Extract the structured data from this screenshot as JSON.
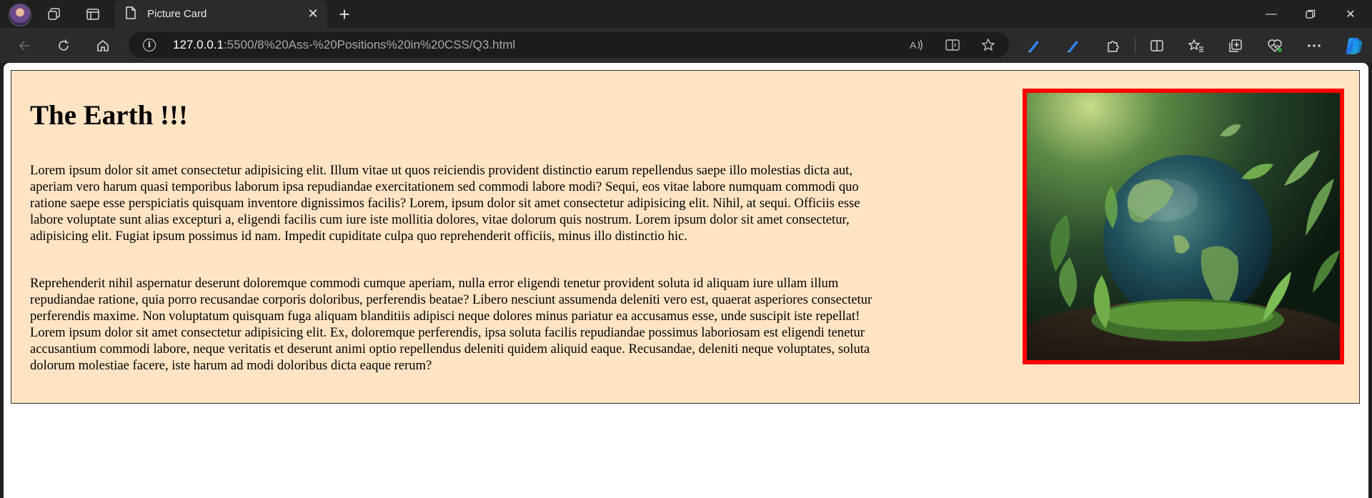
{
  "browser": {
    "tab_title": "Picture Card",
    "url_host": "127.0.0.1",
    "url_path": ":5500/8%20Ass-%20Positions%20in%20CSS/Q3.html"
  },
  "page": {
    "heading": "The Earth !!!",
    "paragraph1": "Lorem ipsum dolor sit amet consectetur adipisicing elit. Illum vitae ut quos reiciendis provident distinctio earum repellendus saepe illo molestias dicta aut, aperiam vero harum quasi temporibus laborum ipsa repudiandae exercitationem sed commodi labore modi? Sequi, eos vitae labore numquam commodi quo ratione saepe esse perspiciatis quisquam inventore dignissimos facilis? Lorem, ipsum dolor sit amet consectetur adipisicing elit. Nihil, at sequi. Officiis esse labore voluptate sunt alias excepturi a, eligendi facilis cum iure iste mollitia dolores, vitae dolorum quis nostrum. Lorem ipsum dolor sit amet consectetur, adipisicing elit. Fugiat ipsum possimus id nam. Impedit cupiditate culpa quo reprehenderit officiis, minus illo distinctio hic.",
    "paragraph2": "Reprehenderit nihil aspernatur deserunt doloremque commodi cumque aperiam, nulla error eligendi tenetur provident soluta id aliquam iure ullam illum repudiandae ratione, quia porro recusandae corporis doloribus, perferendis beatae? Libero nesciunt assumenda deleniti vero est, quaerat asperiores consectetur perferendis maxime. Non voluptatum quisquam fuga aliquam blanditiis adipisci neque dolores minus pariatur ea accusamus esse, unde suscipit iste repellat! Lorem ipsum dolor sit amet consectetur adipisicing elit. Ex, doloremque perferendis, ipsa soluta facilis repudiandae possimus laboriosam est eligendi tenetur accusantium commodi labore, neque veritatis et deserunt animi optio repellendus deleniti quidem aliquid eaque. Recusandae, deleniti neque voluptates, soluta dolorum molestiae facere, iste harum ad modi doloribus dicta eaque rerum?"
  },
  "colors": {
    "card_background": "#ffe4c4",
    "image_border": "#ff0000",
    "browser_chrome": "#202020"
  }
}
